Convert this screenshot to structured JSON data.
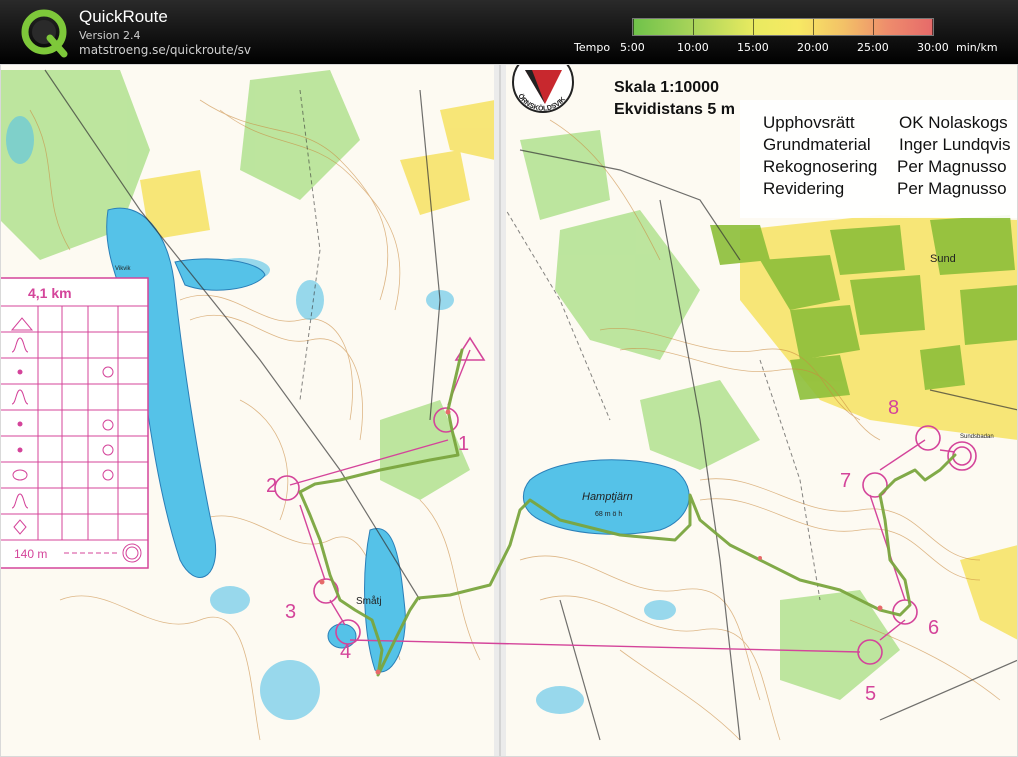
{
  "app": {
    "title": "QuickRoute",
    "version": "Version 2.4",
    "url": "matstroeng.se/quickroute/sv"
  },
  "pace_scale": {
    "label": "Tempo",
    "ticks": [
      "5:00",
      "10:00",
      "15:00",
      "20:00",
      "25:00",
      "30:00"
    ],
    "unit": "min/km",
    "colors": {
      "fast": "#6fc24a",
      "mid": "#f7e964",
      "slow": "#e66a6a"
    }
  },
  "map": {
    "scale": "Skala 1:10000",
    "contour_interval": "Ekvidistans 5 m",
    "credits": [
      {
        "role": "Upphovsrätt",
        "name": "OK Nolaskogs"
      },
      {
        "role": "Grundmaterial",
        "name": "Inger Lundqvis"
      },
      {
        "role": "Rekognosering",
        "name": "Per Magnusso"
      },
      {
        "role": "Revidering",
        "name": "Per Magnusso"
      }
    ],
    "club_logo_text": "ÖRNSKÖLDSVIK",
    "place_names": {
      "sund": "Sund",
      "hamptjarn": "Hamptjärn",
      "hamptjarn_height": "68 m ö h",
      "smatj": "Småtj",
      "sundsbadan": "Sundsbadan",
      "vikvik": "Vikvik"
    },
    "control_numbers": [
      "1",
      "2",
      "3",
      "4",
      "5",
      "6",
      "7",
      "8"
    ],
    "description_sheet": {
      "distance": "4,1 km",
      "final_leg": "140 m"
    },
    "colors": {
      "water": "#55c2e8",
      "open_land": "#f6e262",
      "forest_green": "#9fdc7a",
      "course": "#d4449a",
      "route": "#7aa53e",
      "contour": "#c98a3f"
    }
  }
}
